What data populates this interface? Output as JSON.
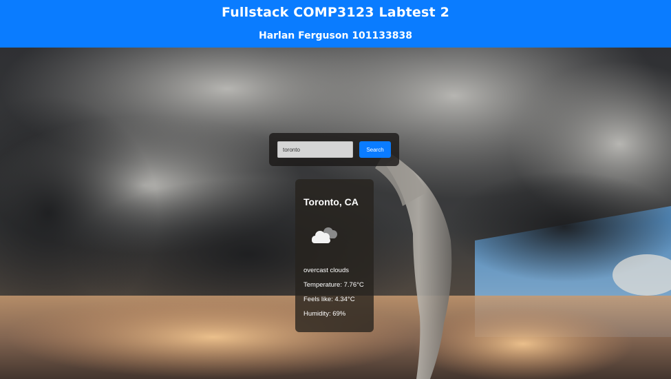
{
  "header": {
    "title": "Fullstack COMP3123 Labtest 2",
    "subtitle": "Harlan Ferguson 101133838",
    "background_color": "#0a7cff"
  },
  "background": {
    "description_icon": "tornado-photo"
  },
  "search": {
    "value": "toronto",
    "button_label": "Search",
    "button_color": "#0a7cff"
  },
  "weather": {
    "city": "Toronto, CA",
    "icon": "cloud-icon",
    "description": "overcast clouds",
    "temperature": "Temperature: 7.76°C",
    "feels_like": "Feels like: 4.34°C",
    "humidity": "Humidity: 69%"
  }
}
